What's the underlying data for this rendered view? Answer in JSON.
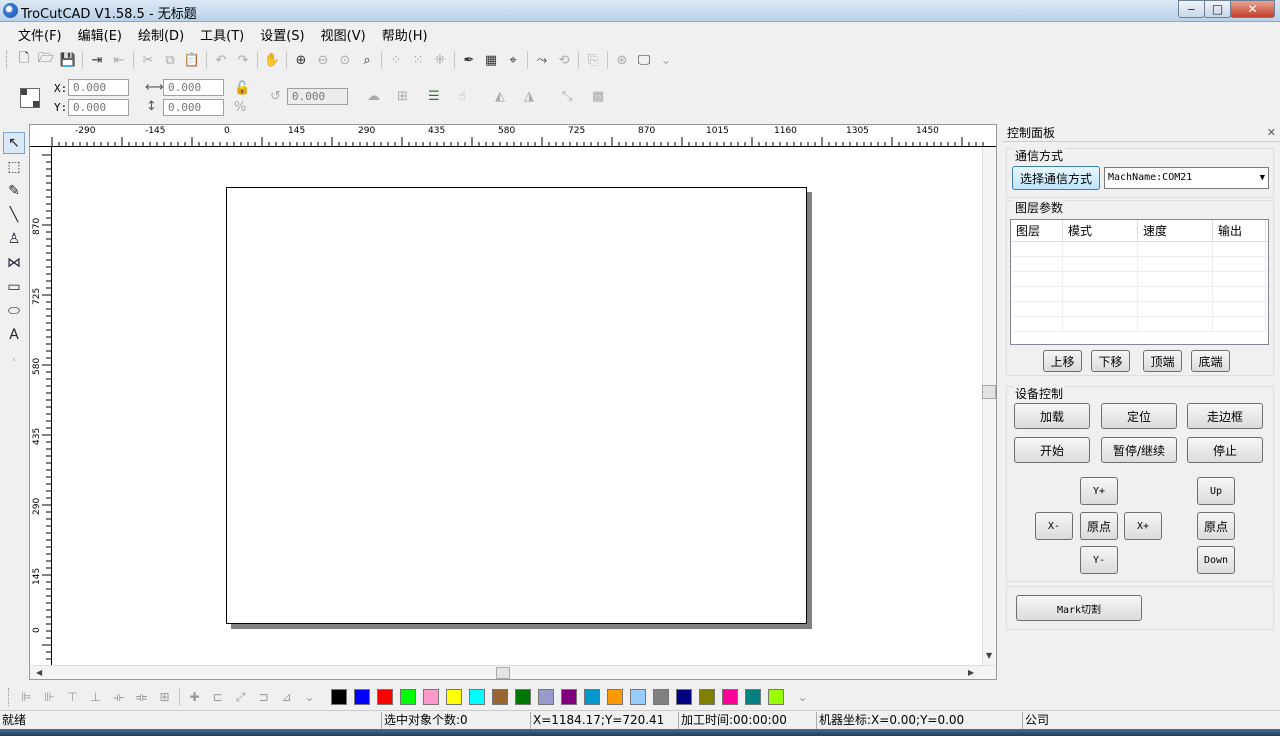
{
  "window": {
    "title": "TroCutCAD V1.58.5 - 无标题",
    "min": "‒",
    "max": "□",
    "close": "✕"
  },
  "menu": [
    "文件(F)",
    "编辑(E)",
    "绘制(D)",
    "工具(T)",
    "设置(S)",
    "视图(V)",
    "帮助(H)"
  ],
  "coords": {
    "x_label": "X:",
    "y_label": "Y:",
    "x_value": "0.000",
    "y_value": "0.000",
    "w_value": "0.000",
    "h_value": "0.000",
    "rotate_value": "0.000",
    "percent": "%"
  },
  "ruler": {
    "h_labels": [
      "-290",
      "-145",
      "0",
      "145",
      "290",
      "435",
      "580",
      "725",
      "870",
      "1015",
      "1160",
      "1305",
      "1450"
    ],
    "v_labels": [
      "870",
      "725",
      "580",
      "435",
      "290",
      "145",
      "0"
    ]
  },
  "panel": {
    "title": "控制面板",
    "close": "✕",
    "comm_title": "通信方式",
    "comm_button": "选择通信方式",
    "comm_value": "MachName:COM21",
    "layer_title": "图层参数",
    "layer_columns": [
      "图层",
      "模式",
      "速度",
      "输出"
    ],
    "layer_buttons": [
      "上移",
      "下移",
      "顶端",
      "底端"
    ],
    "device_title": "设备控制",
    "device_buttons": [
      "加载",
      "定位",
      "走边框",
      "开始",
      "暂停/继续",
      "停止"
    ],
    "jog": {
      "y_plus": "Y+",
      "x_minus": "X-",
      "origin": "原点",
      "x_plus": "X+",
      "y_minus": "Y-",
      "up": "Up",
      "z_origin": "原点",
      "down": "Down"
    },
    "mark_button": "Mark切割"
  },
  "colors": [
    "#000000",
    "#0000ff",
    "#ff0000",
    "#00ff00",
    "#ff99cc",
    "#ffff00",
    "#00ffff",
    "#996633",
    "#007700",
    "#9999cc",
    "#800080",
    "#0099cc",
    "#ff9900",
    "#99ccff",
    "#808080",
    "#000080",
    "#808000",
    "#ff0099",
    "#008080",
    "#99ff00"
  ],
  "status": {
    "ready": "就绪",
    "selected": "选中对象个数:0",
    "cursor": "X=1184.17;Y=720.41",
    "time": "加工时间:00:00:00",
    "machine": "机器坐标:X=0.00;Y=0.00",
    "company": "公司"
  }
}
